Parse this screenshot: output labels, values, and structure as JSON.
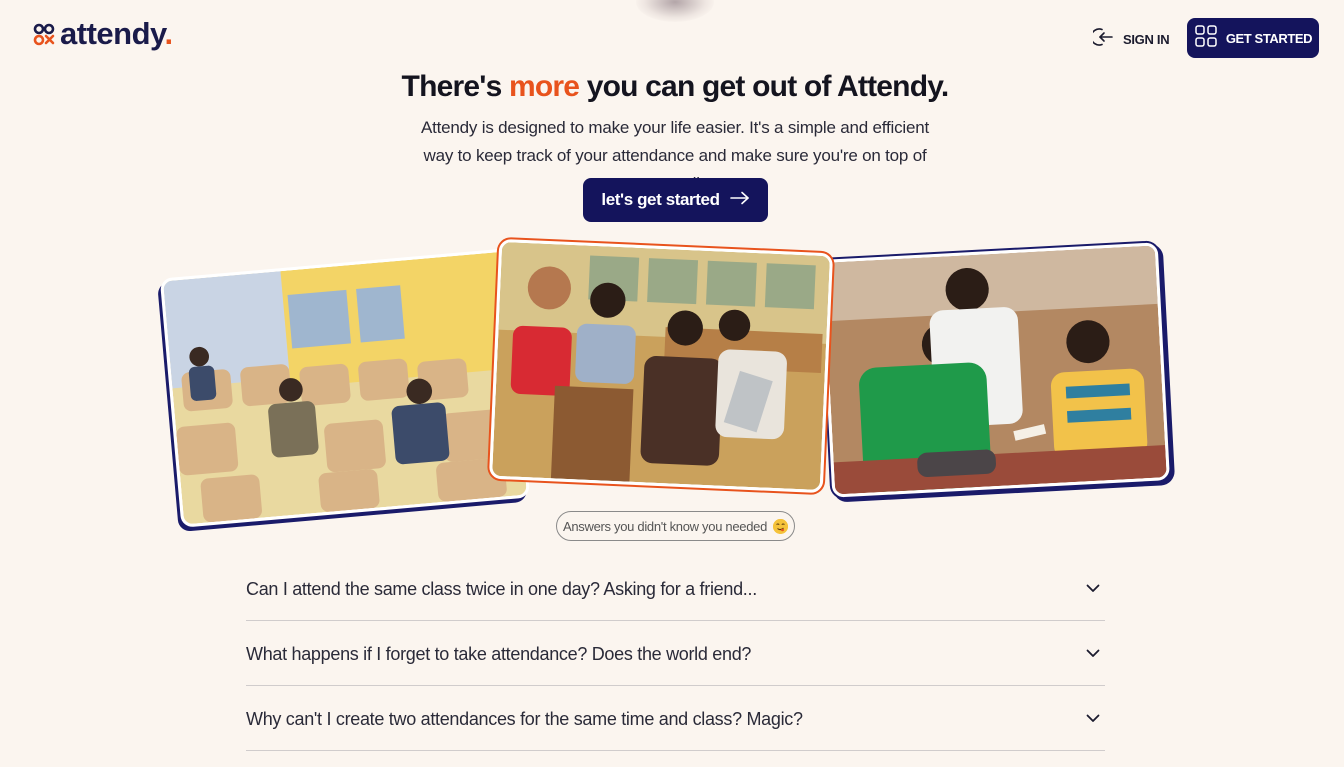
{
  "header": {
    "logo_text": "attendy",
    "logo_dot": ".",
    "signin_label": "SIGN IN",
    "get_started_label": "GET STARTED"
  },
  "hero": {
    "title_before": "There's ",
    "title_accent": "more",
    "title_after": " you can get out of Attendy.",
    "subtitle": "Attendy is designed to make your life easier. It's a simple and efficient way to keep track of your attendance and make sure you're on top of your studies.",
    "cta_label": "let's get started"
  },
  "faq": {
    "pill_label": "Answers you didn't know you needed",
    "items": [
      {
        "question": "Can I attend the same class twice in one day? Asking for a friend..."
      },
      {
        "question": "What happens if I forget to take attendance? Does the world end?"
      },
      {
        "question": "Why can't I create two attendances for the same time and class? Magic?"
      }
    ]
  },
  "colors": {
    "brand_navy": "#14145c",
    "accent_orange": "#e8531d",
    "background": "#fbf5ef"
  },
  "icons": [
    "signin-icon",
    "grid-icon",
    "arrow-right-icon",
    "emoji-icon",
    "chevron-down-icon"
  ]
}
